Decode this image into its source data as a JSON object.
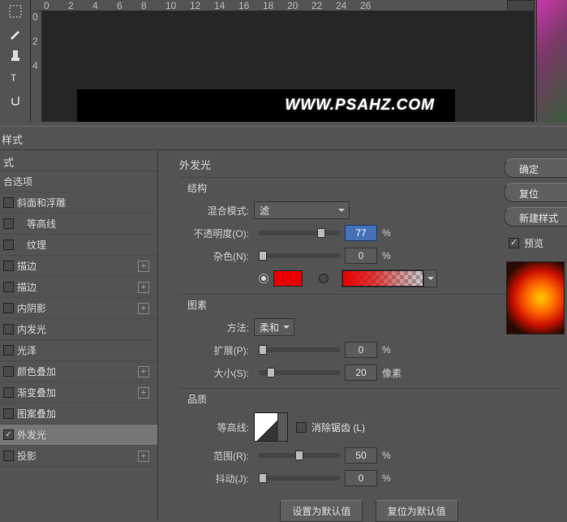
{
  "ruler_h": [
    "0",
    "2",
    "4",
    "6",
    "8",
    "10",
    "12",
    "14",
    "16",
    "18",
    "20",
    "22",
    "24",
    "26"
  ],
  "ruler_v": [
    "0",
    "2",
    "4"
  ],
  "canvas": {
    "watermark": "WWW.PSAHZ.COM"
  },
  "dialog_title": "样式",
  "styles_header": "式",
  "styles": [
    {
      "label": "合选项",
      "check": null,
      "plus": false
    },
    {
      "label": "斜面和浮雕",
      "check": false,
      "plus": false
    },
    {
      "label": "等高线",
      "check": false,
      "plus": false,
      "indent": true
    },
    {
      "label": "纹理",
      "check": false,
      "plus": false,
      "indent": true
    },
    {
      "label": "描边",
      "check": false,
      "plus": true
    },
    {
      "label": "描边",
      "check": false,
      "plus": true
    },
    {
      "label": "内阴影",
      "check": false,
      "plus": true
    },
    {
      "label": "内发光",
      "check": false,
      "plus": false
    },
    {
      "label": "光泽",
      "check": false,
      "plus": false
    },
    {
      "label": "颜色叠加",
      "check": false,
      "plus": true
    },
    {
      "label": "渐变叠加",
      "check": false,
      "plus": true
    },
    {
      "label": "图案叠加",
      "check": false,
      "plus": false
    },
    {
      "label": "外发光",
      "check": true,
      "plus": false,
      "selected": true
    },
    {
      "label": "投影",
      "check": false,
      "plus": true
    }
  ],
  "panel": {
    "title": "外发光",
    "struct": "结构",
    "blend_label": "混合模式:",
    "blend_value": "滤",
    "opacity_label": "不透明度(O):",
    "opacity_value": "77",
    "pct": "%",
    "noise_label": "杂色(N):",
    "noise_value": "0",
    "img_section": "图素",
    "method_label": "方法:",
    "method_value": "柔和",
    "spread_label": "扩展(P):",
    "spread_value": "0",
    "size_label": "大小(S):",
    "size_value": "20",
    "px": "像素",
    "quality": "品质",
    "contour_label": "等高线:",
    "aa_label": "消除锯齿 (L)",
    "range_label": "范围(R):",
    "range_value": "50",
    "jitter_label": "抖动(J):",
    "jitter_value": "0",
    "btn_default1": "设置为默认值",
    "btn_default2": "复位为默认值"
  },
  "right": {
    "ok": "确定",
    "reset": "复位",
    "new_style": "新建样式",
    "preview": "预览"
  }
}
